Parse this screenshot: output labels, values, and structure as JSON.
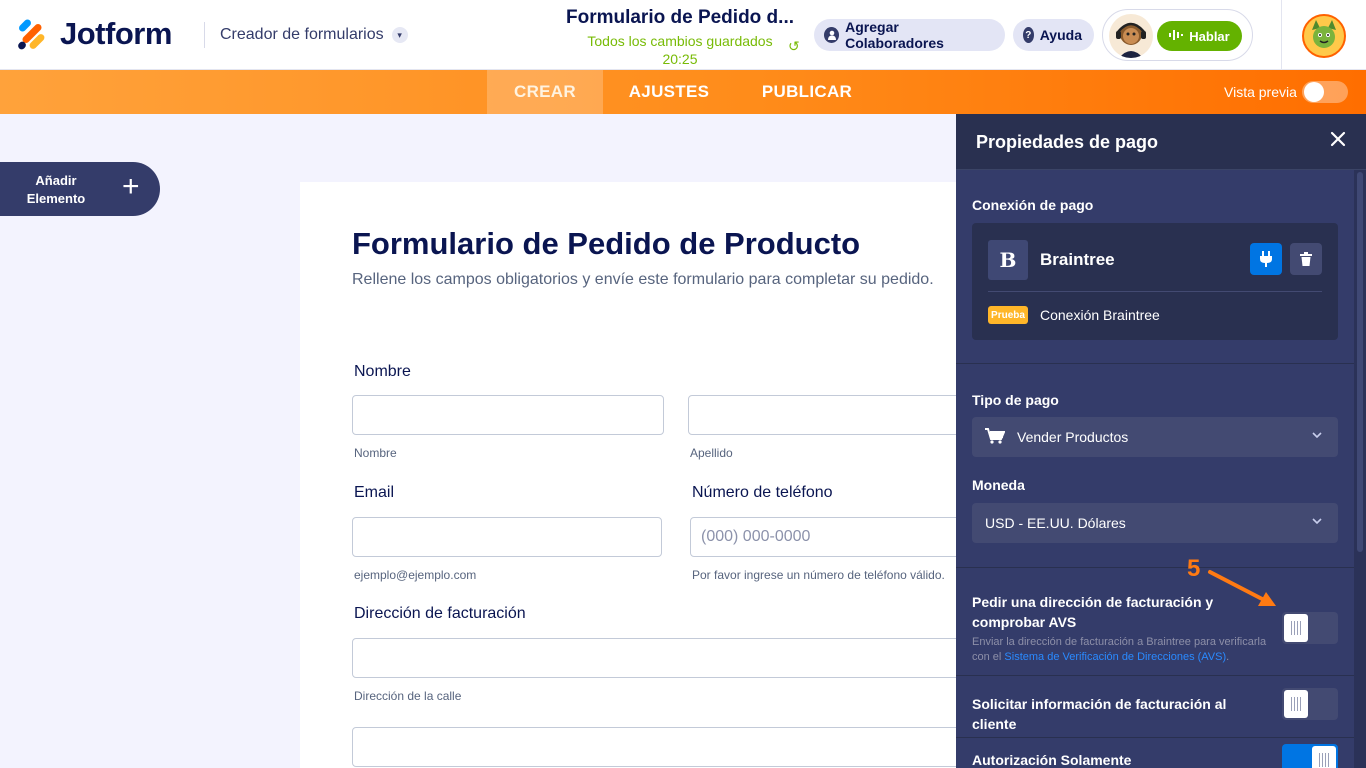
{
  "header": {
    "brand": "Jotform",
    "builder_label": "Creador de formularios",
    "form_title": "Formulario de Pedido d...",
    "saved_status": "Todos los cambios guardados",
    "saved_time": "20:25",
    "collab_button": "Agregar Colaboradores",
    "help_button": "Ayuda",
    "talk_button": "Hablar"
  },
  "nav": {
    "tabs": [
      {
        "label": "CREAR",
        "active": true
      },
      {
        "label": "AJUSTES",
        "active": false
      },
      {
        "label": "PUBLICAR",
        "active": false
      }
    ],
    "preview_label": "Vista previa",
    "preview_on": false
  },
  "add_element": {
    "line1": "Añadir",
    "line2": "Elemento"
  },
  "form": {
    "title": "Formulario de Pedido de Producto",
    "subtitle": "Rellene los campos obligatorios y envíe este formulario para completar su pedido.",
    "name_label": "Nombre",
    "first_hint": "Nombre",
    "last_hint": "Apellido",
    "email_label": "Email",
    "email_hint": "ejemplo@ejemplo.com",
    "phone_label": "Número de teléfono",
    "phone_placeholder": "(000) 000-0000",
    "phone_hint": "Por favor ingrese un número de teléfono válido.",
    "address_label": "Dirección de facturación",
    "street_hint": "Dirección de la calle"
  },
  "panel": {
    "title": "Propiedades de pago",
    "connection_label": "Conexión de pago",
    "gateway_initial": "B",
    "gateway_name": "Braintree",
    "test_badge": "Prueba",
    "connection_name": "Conexión Braintree",
    "payment_type_label": "Tipo de pago",
    "payment_type_value": "Vender Productos",
    "currency_label": "Moneda",
    "currency_value": "USD - EE.UU. Dólares",
    "avs_title": "Pedir una dirección de facturación y comprobar AVS",
    "avs_desc_prefix": "Enviar la dirección de facturación a Braintree para verificarla con el",
    "avs_desc_link": "Sistema de Verificación de Direcciones (AVS)",
    "avs_desc_suffix": ".",
    "avs_on": false,
    "billing_info_title": "Solicitar información de facturación al cliente",
    "billing_info_on": false,
    "auth_only_title": "Autorización Solamente",
    "auth_only_on": true
  },
  "annotation": {
    "step": "5"
  },
  "colors": {
    "orange": "#ff6e00",
    "navy": "#343c6a",
    "blue": "#0075e3",
    "green": "#64b200"
  }
}
